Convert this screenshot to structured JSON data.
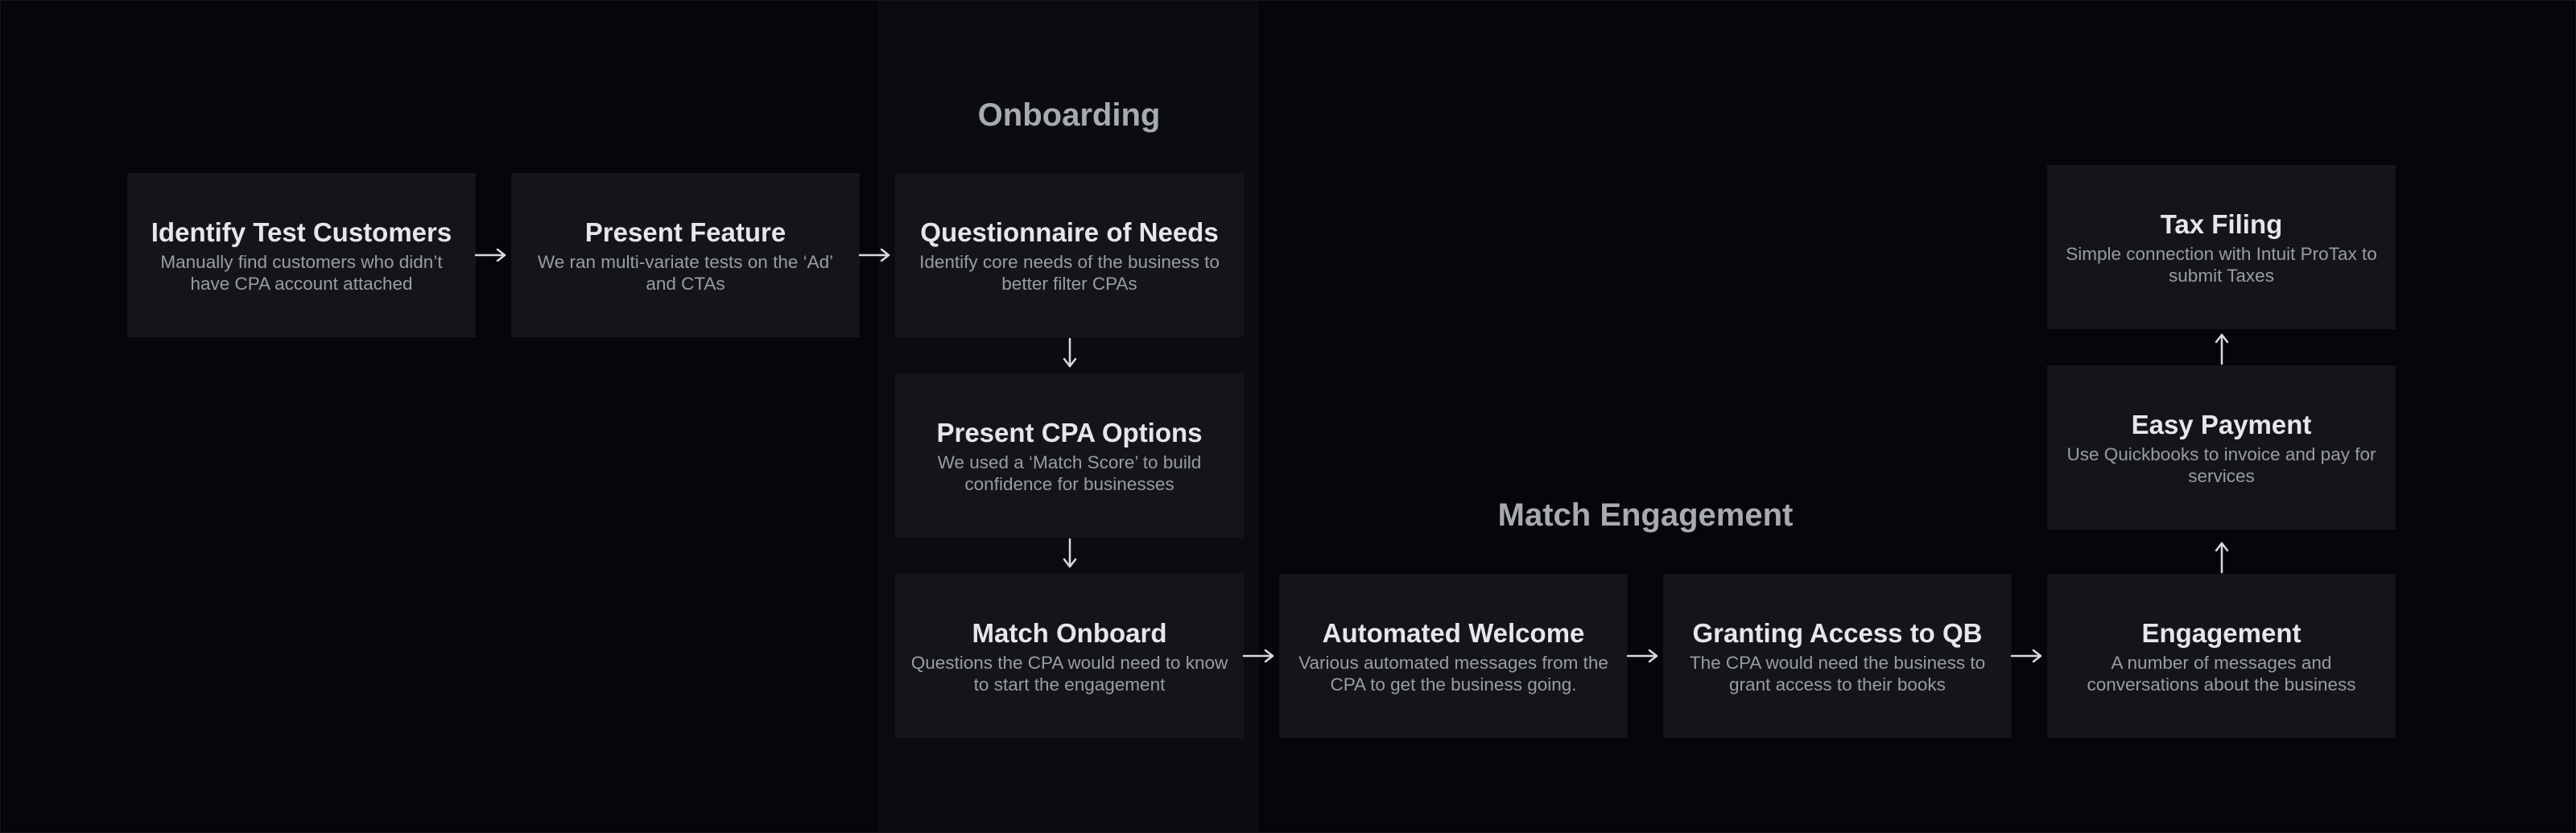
{
  "sections": {
    "onboarding": "Onboarding",
    "match_engagement": "Match Engagement"
  },
  "steps": [
    {
      "id": "identify",
      "title": "Identify Test Customers",
      "desc": "Manually find customers who didn’t have CPA account attached"
    },
    {
      "id": "present-feature",
      "title": "Present Feature",
      "desc": "We ran multi-variate tests on the ‘Ad’ and CTAs"
    },
    {
      "id": "questionnaire",
      "title": "Questionnaire of Needs",
      "desc": "Identify core needs of the business to better filter CPAs"
    },
    {
      "id": "present-cpa",
      "title": "Present CPA Options",
      "desc": "We used a ‘Match Score’ to build confidence for businesses"
    },
    {
      "id": "match-onboard",
      "title": "Match Onboard",
      "desc": "Questions the CPA would need to know to start the engagement"
    },
    {
      "id": "automated-welcome",
      "title": "Automated Welcome",
      "desc": "Various automated messages from the CPA to get the business going."
    },
    {
      "id": "granting-access",
      "title": "Granting Access to QB",
      "desc": "The CPA would need the business to grant access to their books"
    },
    {
      "id": "engagement",
      "title": "Engagement",
      "desc": "A number of messages and conversations about the business"
    },
    {
      "id": "easy-payment",
      "title": "Easy Payment",
      "desc": "Use Quickbooks to invoice and pay for services"
    },
    {
      "id": "tax-filing",
      "title": "Tax Filing",
      "desc": "Simple connection with Intuit ProTax to submit Taxes"
    }
  ]
}
